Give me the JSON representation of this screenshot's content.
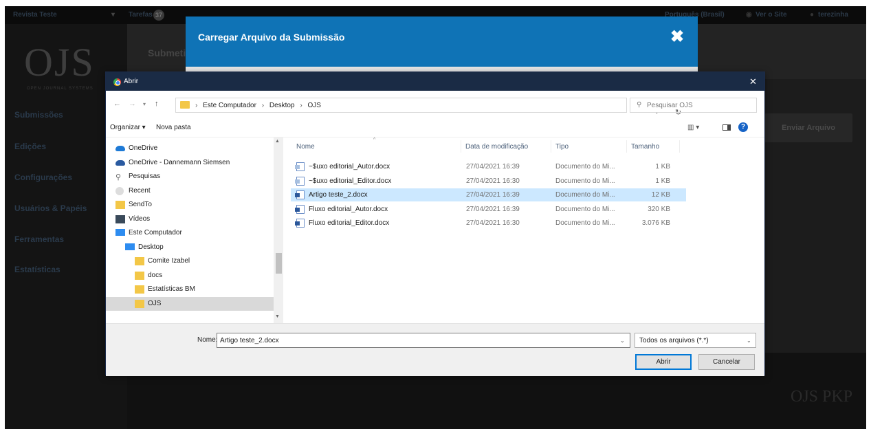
{
  "ojs": {
    "journal": "Revista Teste",
    "tasks_label": "Tarefas",
    "tasks_count": "37",
    "lang": "Português (Brasil)",
    "view_site": "Ver o Site",
    "user": "terezinha",
    "logo": "OJS",
    "logo_sub": "OPEN JOURNAL SYSTEMS",
    "header_title": "Submeti",
    "sidebar": [
      "Submissões",
      "Edições",
      "Configurações",
      "Usuários & Papéis",
      "Ferramentas",
      "Estatísticas"
    ],
    "send_file_button": "Enviar Arquivo",
    "footer_logo": "OJS PKP"
  },
  "modal": {
    "title": "Carregar Arquivo da Submissão",
    "close": "✖"
  },
  "dialog": {
    "title": "Abrir",
    "close": "✕",
    "address": [
      "Este Computador",
      "Desktop",
      "OJS"
    ],
    "search_placeholder": "Pesquisar OJS",
    "toolbar": {
      "organize": "Organizar ▾",
      "new_folder": "Nova pasta"
    },
    "nav": [
      {
        "label": "OneDrive",
        "icon": "onedrive-icon",
        "indent": 0
      },
      {
        "label": "OneDrive - Dannemann Siemsen",
        "icon": "onedrive-icon",
        "indent": 0
      },
      {
        "label": "Pesquisas",
        "icon": "search-icon",
        "indent": 0
      },
      {
        "label": "Recent",
        "icon": "recent-icon",
        "indent": 0
      },
      {
        "label": "SendTo",
        "icon": "folder-icon",
        "indent": 0
      },
      {
        "label": "Vídeos",
        "icon": "video-icon",
        "indent": 0
      },
      {
        "label": "Este Computador",
        "icon": "computer-icon",
        "indent": 0
      },
      {
        "label": "Desktop",
        "icon": "desktop-icon",
        "indent": 1
      },
      {
        "label": "Comite Izabel",
        "icon": "folder-icon",
        "indent": 2
      },
      {
        "label": "docs",
        "icon": "folder-icon",
        "indent": 2
      },
      {
        "label": "Estatísticas BM",
        "icon": "folder-icon",
        "indent": 2
      },
      {
        "label": "OJS",
        "icon": "folder-icon",
        "indent": 2,
        "selected": true
      }
    ],
    "columns": {
      "name": "Nome",
      "date": "Data de modificação",
      "type": "Tipo",
      "size": "Tamanho"
    },
    "files": [
      {
        "name": "~$uxo editorial_Autor.docx",
        "date": "27/04/2021 16:39",
        "type": "Documento do Mi...",
        "size": "1 KB",
        "lock": true
      },
      {
        "name": "~$uxo editorial_Editor.docx",
        "date": "27/04/2021 16:30",
        "type": "Documento do Mi...",
        "size": "1 KB",
        "lock": true
      },
      {
        "name": "Artigo teste_2.docx",
        "date": "27/04/2021 16:39",
        "type": "Documento do Mi...",
        "size": "12 KB",
        "selected": true
      },
      {
        "name": "Fluxo editorial_Autor.docx",
        "date": "27/04/2021 16:39",
        "type": "Documento do Mi...",
        "size": "320 KB"
      },
      {
        "name": "Fluxo editorial_Editor.docx",
        "date": "27/04/2021 16:30",
        "type": "Documento do Mi...",
        "size": "3.076 KB"
      }
    ],
    "name_label": "Nome:",
    "name_value": "Artigo teste_2.docx",
    "filter": "Todos os arquivos (*.*)",
    "open_button": "Abrir",
    "cancel_button": "Cancelar"
  }
}
